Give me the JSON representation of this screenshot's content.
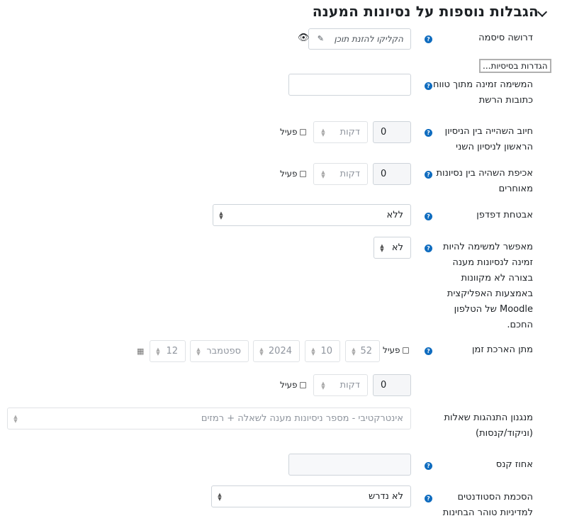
{
  "section": {
    "title": "הגבלות נוספות על נסיונות המענה"
  },
  "password": {
    "label": "דרושה סיסמה",
    "placeholder": "הקליקו להזנת תוכן"
  },
  "basic_settings_button": "הגדרות בסיסיות...",
  "network": {
    "label_line1": "המשימה זמינה מתוך טווח",
    "label_line2": "כתובות הרשת",
    "value": ""
  },
  "delay1": {
    "label_line1": "חיוב השהייה בין הניסיון",
    "label_line2": "הראשון לניסיון השני",
    "number": "0",
    "unit": "דקות",
    "enable_label": "פעיל"
  },
  "delay2": {
    "label_line1": "אכיפת השהיה בין נסיונות",
    "label_line2": "מאוחרים",
    "number": "0",
    "unit": "דקות",
    "enable_label": "פעיל"
  },
  "browser_security": {
    "label": "אבטחת דפדפן",
    "value": "ללא"
  },
  "moodle_app": {
    "label_lines": [
      "מאפשר למשימה להיות",
      "זמינה לנסיונות מענה",
      "בצורה לא מקוונות",
      "באמצעות האפליקצית",
      "Moodle של הטלפון",
      "החכם."
    ],
    "value": "לא"
  },
  "extension": {
    "label": "מתן הארכת זמן",
    "enable_label": "פעיל",
    "minute": "52",
    "hour": "10",
    "year": "2024",
    "month": "ספטמבר",
    "day": "12",
    "number": "0",
    "unit": "דקות",
    "enable_label2": "פעיל"
  },
  "behaviour": {
    "label_line1": "מנגנון התנהגות שאלות",
    "label_line2": "(וניקוד/קנסות)",
    "value": "אינטרקטיבי - מספר ניסיונות מענה לשאלה + רמזים"
  },
  "penalty": {
    "label": "אחוז קנס",
    "value": ""
  },
  "consent": {
    "label_line1": "הסכמת הסטודנטים",
    "label_line2": "למדיניות טוהר הבחינות",
    "value": "לא נדרש"
  }
}
